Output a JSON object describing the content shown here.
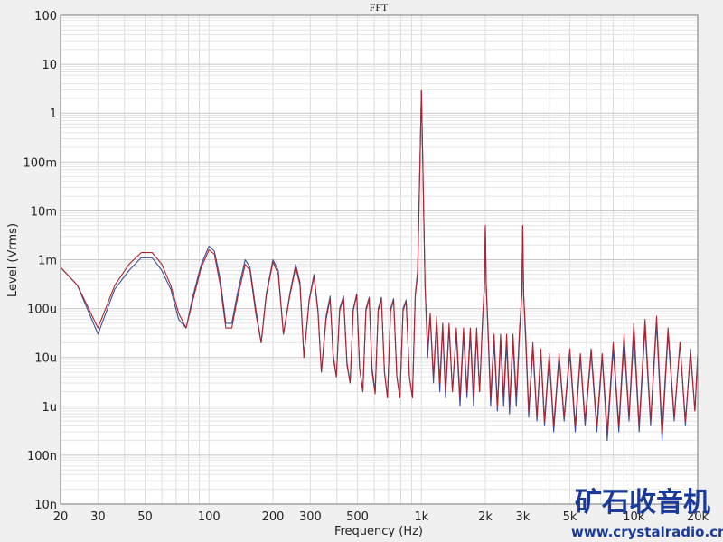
{
  "chart_data": {
    "type": "line",
    "title": "FFT",
    "xlabel": "Frequency (Hz)",
    "ylabel": "Level (Vrms)",
    "x_scale": "log",
    "y_scale": "log",
    "xlim": [
      20,
      20000
    ],
    "ylim": [
      1e-08,
      100
    ],
    "grid": true,
    "x_ticks": [
      {
        "v": 20,
        "label": "20"
      },
      {
        "v": 30,
        "label": "30"
      },
      {
        "v": 50,
        "label": "50"
      },
      {
        "v": 100,
        "label": "100"
      },
      {
        "v": 200,
        "label": "200"
      },
      {
        "v": 300,
        "label": "300"
      },
      {
        "v": 500,
        "label": "500"
      },
      {
        "v": 1000,
        "label": "1k"
      },
      {
        "v": 2000,
        "label": "2k"
      },
      {
        "v": 3000,
        "label": "3k"
      },
      {
        "v": 5000,
        "label": "5k"
      },
      {
        "v": 10000,
        "label": "10k"
      },
      {
        "v": 20000,
        "label": "20k"
      }
    ],
    "y_ticks": [
      {
        "v": 100,
        "label": "100"
      },
      {
        "v": 10,
        "label": "10"
      },
      {
        "v": 1,
        "label": "1"
      },
      {
        "v": 0.1,
        "label": "100m"
      },
      {
        "v": 0.01,
        "label": "10m"
      },
      {
        "v": 0.001,
        "label": "1m"
      },
      {
        "v": 0.0001,
        "label": "100u"
      },
      {
        "v": 1e-05,
        "label": "10u"
      },
      {
        "v": 1e-06,
        "label": "1u"
      },
      {
        "v": 1e-07,
        "label": "100n"
      },
      {
        "v": 1e-08,
        "label": "10n"
      }
    ],
    "series": [
      {
        "color": "#3a4f9e",
        "points": [
          [
            20,
            0.0007
          ],
          [
            24,
            0.0003
          ],
          [
            30,
            3e-05
          ],
          [
            36,
            0.00025
          ],
          [
            42,
            0.0006
          ],
          [
            48,
            0.0011
          ],
          [
            54,
            0.0011
          ],
          [
            60,
            0.0006
          ],
          [
            66,
            0.00025
          ],
          [
            72,
            6e-05
          ],
          [
            78,
            4e-05
          ],
          [
            84,
            0.00018
          ],
          [
            92,
            0.0008
          ],
          [
            100,
            0.0019
          ],
          [
            106,
            0.0015
          ],
          [
            113,
            0.0004
          ],
          [
            120,
            5e-05
          ],
          [
            128,
            5e-05
          ],
          [
            136,
            0.0002
          ],
          [
            148,
            0.001
          ],
          [
            156,
            0.0007
          ],
          [
            166,
            0.0001
          ],
          [
            176,
            2e-05
          ],
          [
            186,
            0.0002
          ],
          [
            200,
            0.001
          ],
          [
            212,
            0.0006
          ],
          [
            224,
            3e-05
          ],
          [
            240,
            0.0002
          ],
          [
            256,
            0.0008
          ],
          [
            268,
            0.00035
          ],
          [
            280,
            1e-05
          ],
          [
            296,
            0.00015
          ],
          [
            312,
            0.0005
          ],
          [
            326,
            9e-05
          ],
          [
            338,
            5e-06
          ],
          [
            356,
            7e-05
          ],
          [
            372,
            0.00018
          ],
          [
            384,
            1e-05
          ],
          [
            398,
            4e-06
          ],
          [
            412,
            0.0001
          ],
          [
            430,
            0.00018
          ],
          [
            446,
            8e-06
          ],
          [
            462,
            3e-06
          ],
          [
            478,
            0.0001
          ],
          [
            496,
            0.0002
          ],
          [
            512,
            6e-06
          ],
          [
            530,
            2e-06
          ],
          [
            548,
            0.0001
          ],
          [
            568,
            0.00017
          ],
          [
            586,
            6e-06
          ],
          [
            606,
            2e-06
          ],
          [
            626,
            0.0001
          ],
          [
            648,
            0.00017
          ],
          [
            670,
            5e-06
          ],
          [
            692,
            1.5e-06
          ],
          [
            716,
            0.0001
          ],
          [
            740,
            0.00016
          ],
          [
            766,
            4e-06
          ],
          [
            792,
            1.5e-06
          ],
          [
            820,
            0.0001
          ],
          [
            848,
            0.00015
          ],
          [
            878,
            4e-06
          ],
          [
            908,
            1.5e-06
          ],
          [
            936,
            0.0002
          ],
          [
            960,
            0.0006
          ],
          [
            985,
            0.1
          ],
          [
            1000,
            2.8
          ],
          [
            1015,
            0.1
          ],
          [
            1040,
            0.0003
          ],
          [
            1070,
            1e-05
          ],
          [
            1100,
            7e-05
          ],
          [
            1140,
            3e-06
          ],
          [
            1180,
            6e-05
          ],
          [
            1220,
            2e-06
          ],
          [
            1260,
            4e-05
          ],
          [
            1300,
            1.5e-06
          ],
          [
            1350,
            4e-05
          ],
          [
            1400,
            2e-06
          ],
          [
            1460,
            3e-05
          ],
          [
            1520,
            1e-06
          ],
          [
            1580,
            3e-05
          ],
          [
            1640,
            1.5e-06
          ],
          [
            1700,
            3e-05
          ],
          [
            1760,
            1e-06
          ],
          [
            1820,
            3e-05
          ],
          [
            1880,
            2e-06
          ],
          [
            1940,
            5e-05
          ],
          [
            1980,
            0.0003
          ],
          [
            2000,
            0.005
          ],
          [
            2020,
            0.0003
          ],
          [
            2060,
            3e-05
          ],
          [
            2120,
            1e-06
          ],
          [
            2200,
            2e-05
          ],
          [
            2280,
            8e-07
          ],
          [
            2360,
            2e-05
          ],
          [
            2440,
            1e-06
          ],
          [
            2520,
            2e-05
          ],
          [
            2600,
            7e-07
          ],
          [
            2700,
            2e-05
          ],
          [
            2800,
            1e-06
          ],
          [
            2900,
            3e-05
          ],
          [
            2970,
            0.0002
          ],
          [
            3000,
            0.005
          ],
          [
            3030,
            0.0002
          ],
          [
            3100,
            2e-05
          ],
          [
            3200,
            6e-07
          ],
          [
            3350,
            1.5e-05
          ],
          [
            3500,
            5e-07
          ],
          [
            3650,
            1.2e-05
          ],
          [
            3800,
            4e-07
          ],
          [
            4000,
            1e-05
          ],
          [
            4200,
            3e-07
          ],
          [
            4450,
            1e-05
          ],
          [
            4700,
            5e-07
          ],
          [
            5000,
            1.2e-05
          ],
          [
            5300,
            3e-07
          ],
          [
            5600,
            1e-05
          ],
          [
            5900,
            4e-07
          ],
          [
            6300,
            1.2e-05
          ],
          [
            6700,
            3e-07
          ],
          [
            7100,
            1e-05
          ],
          [
            7500,
            2e-07
          ],
          [
            8000,
            1.5e-05
          ],
          [
            8500,
            3e-07
          ],
          [
            9000,
            2e-05
          ],
          [
            9500,
            5e-07
          ],
          [
            10000,
            3e-05
          ],
          [
            10600,
            3e-07
          ],
          [
            11300,
            4e-05
          ],
          [
            12000,
            4e-07
          ],
          [
            12800,
            5e-05
          ],
          [
            13600,
            2e-07
          ],
          [
            14500,
            3e-05
          ],
          [
            15500,
            5e-07
          ],
          [
            16500,
            2e-05
          ],
          [
            17500,
            4e-07
          ],
          [
            18500,
            1.5e-05
          ],
          [
            19400,
            8e-07
          ],
          [
            20000,
            1.2e-05
          ]
        ]
      },
      {
        "color": "#b0222e",
        "points": [
          [
            20,
            0.0007
          ],
          [
            24,
            0.0003
          ],
          [
            30,
            4e-05
          ],
          [
            36,
            0.0003
          ],
          [
            42,
            0.0008
          ],
          [
            48,
            0.0014
          ],
          [
            54,
            0.0014
          ],
          [
            60,
            0.0008
          ],
          [
            66,
            0.0003
          ],
          [
            72,
            8e-05
          ],
          [
            78,
            4e-05
          ],
          [
            84,
            0.00015
          ],
          [
            92,
            0.0007
          ],
          [
            100,
            0.0016
          ],
          [
            106,
            0.0013
          ],
          [
            113,
            0.0003
          ],
          [
            120,
            4e-05
          ],
          [
            128,
            4e-05
          ],
          [
            136,
            0.00016
          ],
          [
            148,
            0.0008
          ],
          [
            156,
            0.0006
          ],
          [
            166,
            8e-05
          ],
          [
            176,
            2e-05
          ],
          [
            186,
            0.00018
          ],
          [
            200,
            0.0009
          ],
          [
            212,
            0.0005
          ],
          [
            224,
            3e-05
          ],
          [
            240,
            0.00018
          ],
          [
            256,
            0.0007
          ],
          [
            268,
            0.0003
          ],
          [
            280,
            1e-05
          ],
          [
            296,
            0.00014
          ],
          [
            312,
            0.00045
          ],
          [
            326,
            8e-05
          ],
          [
            338,
            5e-06
          ],
          [
            356,
            6e-05
          ],
          [
            372,
            0.00016
          ],
          [
            384,
            1.2e-05
          ],
          [
            398,
            4e-06
          ],
          [
            412,
            9e-05
          ],
          [
            430,
            0.00017
          ],
          [
            446,
            7e-06
          ],
          [
            462,
            3e-06
          ],
          [
            478,
            9e-05
          ],
          [
            496,
            0.00019
          ],
          [
            512,
            6e-06
          ],
          [
            530,
            2e-06
          ],
          [
            548,
            9e-05
          ],
          [
            568,
            0.00016
          ],
          [
            586,
            5e-06
          ],
          [
            606,
            1.8e-06
          ],
          [
            626,
            9e-05
          ],
          [
            648,
            0.00016
          ],
          [
            670,
            5e-06
          ],
          [
            692,
            1.5e-06
          ],
          [
            716,
            9e-05
          ],
          [
            740,
            0.00015
          ],
          [
            766,
            4e-06
          ],
          [
            792,
            1.5e-06
          ],
          [
            820,
            9e-05
          ],
          [
            848,
            0.00014
          ],
          [
            878,
            4e-06
          ],
          [
            908,
            1.5e-06
          ],
          [
            936,
            0.00018
          ],
          [
            960,
            0.0005
          ],
          [
            985,
            0.1
          ],
          [
            1000,
            2.9
          ],
          [
            1015,
            0.1
          ],
          [
            1040,
            0.0003
          ],
          [
            1070,
            1.5e-05
          ],
          [
            1100,
            8e-05
          ],
          [
            1140,
            4e-06
          ],
          [
            1180,
            7e-05
          ],
          [
            1220,
            3e-06
          ],
          [
            1260,
            5e-05
          ],
          [
            1300,
            2e-06
          ],
          [
            1350,
            5e-05
          ],
          [
            1400,
            2e-06
          ],
          [
            1460,
            4e-05
          ],
          [
            1520,
            1.5e-06
          ],
          [
            1580,
            4e-05
          ],
          [
            1640,
            2e-06
          ],
          [
            1700,
            4e-05
          ],
          [
            1760,
            1.5e-06
          ],
          [
            1820,
            4e-05
          ],
          [
            1880,
            2e-06
          ],
          [
            1940,
            6e-05
          ],
          [
            1980,
            0.0003
          ],
          [
            2000,
            0.005
          ],
          [
            2020,
            0.0003
          ],
          [
            2060,
            4e-05
          ],
          [
            2120,
            1.5e-06
          ],
          [
            2200,
            3e-05
          ],
          [
            2280,
            1e-06
          ],
          [
            2360,
            3e-05
          ],
          [
            2440,
            1.5e-06
          ],
          [
            2520,
            3e-05
          ],
          [
            2600,
            1e-06
          ],
          [
            2700,
            3e-05
          ],
          [
            2800,
            1.5e-06
          ],
          [
            2900,
            4e-05
          ],
          [
            2970,
            0.0002
          ],
          [
            3000,
            0.005
          ],
          [
            3030,
            0.0002
          ],
          [
            3100,
            3e-05
          ],
          [
            3200,
            8e-07
          ],
          [
            3350,
            2e-05
          ],
          [
            3500,
            6e-07
          ],
          [
            3650,
            1.5e-05
          ],
          [
            3800,
            5e-07
          ],
          [
            4000,
            1.2e-05
          ],
          [
            4200,
            4e-07
          ],
          [
            4450,
            1.2e-05
          ],
          [
            4700,
            6e-07
          ],
          [
            5000,
            1.5e-05
          ],
          [
            5300,
            4e-07
          ],
          [
            5600,
            1.2e-05
          ],
          [
            5900,
            5e-07
          ],
          [
            6300,
            1.5e-05
          ],
          [
            6700,
            4e-07
          ],
          [
            7100,
            1.2e-05
          ],
          [
            7500,
            3e-07
          ],
          [
            8000,
            2e-05
          ],
          [
            8500,
            4e-07
          ],
          [
            9000,
            3e-05
          ],
          [
            9500,
            6e-07
          ],
          [
            10000,
            5e-05
          ],
          [
            10600,
            4e-07
          ],
          [
            11300,
            6e-05
          ],
          [
            12000,
            5e-07
          ],
          [
            12800,
            7e-05
          ],
          [
            13600,
            3e-07
          ],
          [
            14500,
            4e-05
          ],
          [
            15500,
            6e-07
          ],
          [
            16500,
            2e-05
          ],
          [
            17500,
            5e-07
          ],
          [
            18500,
            1.2e-05
          ],
          [
            19400,
            8e-07
          ],
          [
            20000,
            1e-05
          ]
        ]
      }
    ]
  },
  "watermark": {
    "cn": "矿石收音机",
    "url": "www.crystalradio.cn"
  }
}
